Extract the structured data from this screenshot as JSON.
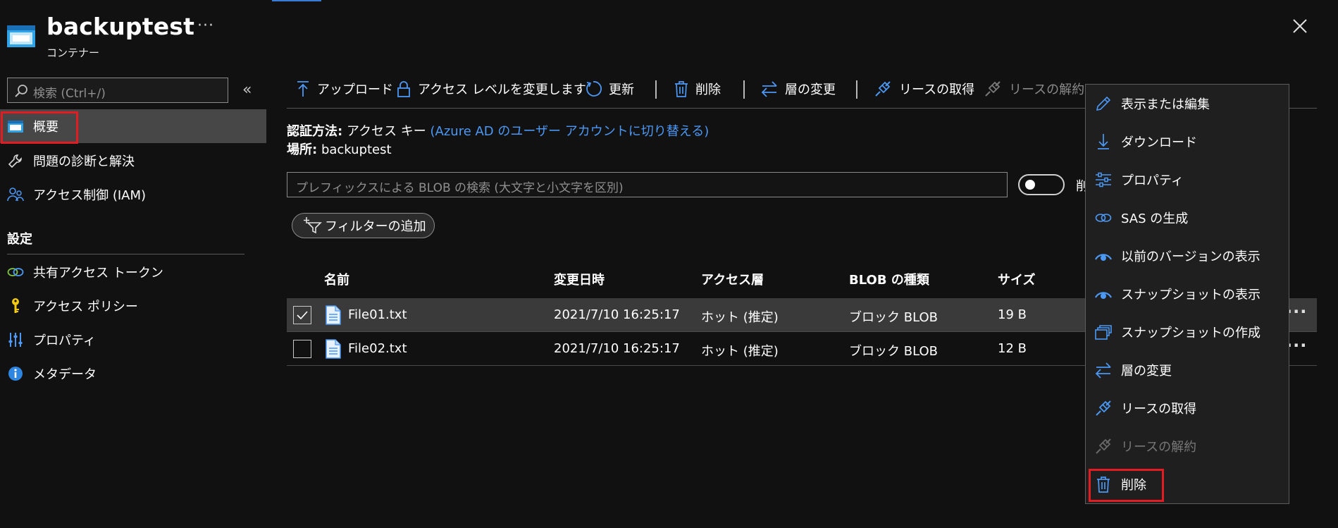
{
  "header": {
    "title": "backuptest",
    "subtitle": "コンテナー",
    "more": "···"
  },
  "sidebar": {
    "search_placeholder": "検索 (Ctrl+/)",
    "collapse": "«",
    "items": [
      {
        "label": "概要",
        "icon": "container-icon"
      },
      {
        "label": "問題の診断と解決",
        "icon": "wrench-icon"
      },
      {
        "label": "アクセス制御 (IAM)",
        "icon": "people-icon"
      }
    ],
    "settings_header": "設定",
    "settings_items": [
      {
        "label": "共有アクセス トークン",
        "icon": "link-icon"
      },
      {
        "label": "アクセス ポリシー",
        "icon": "key-icon"
      },
      {
        "label": "プロパティ",
        "icon": "sliders-icon"
      },
      {
        "label": "メタデータ",
        "icon": "info-icon"
      }
    ]
  },
  "toolbar": {
    "upload": "アップロード",
    "access_level": "アクセス レベルを変更します",
    "refresh": "更新",
    "delete": "削除",
    "change_tier": "層の変更",
    "acquire_lease": "リースの取得",
    "break_lease": "リースの解約"
  },
  "info": {
    "auth_label": "認証方法:",
    "auth_value": "アクセス キー",
    "auth_link": "(Azure AD のユーザー アカウントに切り替える)",
    "location_label": "場所:",
    "location_value": "backuptest"
  },
  "blob_search": {
    "placeholder": "プレフィックスによる BLOB の検索 (大文字と小文字を区別)"
  },
  "toggle_label_partial": "削",
  "filter": {
    "label": "フィルターの追加"
  },
  "table": {
    "columns": [
      "名前",
      "変更日時",
      "アクセス層",
      "BLOB の種類",
      "サイズ"
    ],
    "rows": [
      {
        "checked": true,
        "name": "File01.txt",
        "modified": "2021/7/10 16:25:17",
        "tier": "ホット (推定)",
        "type": "ブロック BLOB",
        "size": "19 B",
        "more": "···"
      },
      {
        "checked": false,
        "name": "File02.txt",
        "modified": "2021/7/10 16:25:17",
        "tier": "ホット (推定)",
        "type": "ブロック BLOB",
        "size": "12 B",
        "more": "···"
      }
    ]
  },
  "context_menu": {
    "items": [
      {
        "label": "表示または編集",
        "icon": "pencil-icon"
      },
      {
        "label": "ダウンロード",
        "icon": "download-icon"
      },
      {
        "label": "プロパティ",
        "icon": "sliders-icon"
      },
      {
        "label": "SAS の生成",
        "icon": "link-icon"
      },
      {
        "label": "以前のバージョンの表示",
        "icon": "eye-icon"
      },
      {
        "label": "スナップショットの表示",
        "icon": "eye-icon"
      },
      {
        "label": "スナップショットの作成",
        "icon": "snapshot-icon"
      },
      {
        "label": "層の変更",
        "icon": "swap-icon"
      },
      {
        "label": "リースの取得",
        "icon": "lease-icon"
      },
      {
        "label": "リースの解約",
        "icon": "break-lease-icon",
        "disabled": true
      },
      {
        "label": "削除",
        "icon": "trash-icon"
      }
    ]
  },
  "colors": {
    "accent_blue": "#4b98f5",
    "highlight_red": "#e31b23",
    "selected_bg": "#474747"
  }
}
